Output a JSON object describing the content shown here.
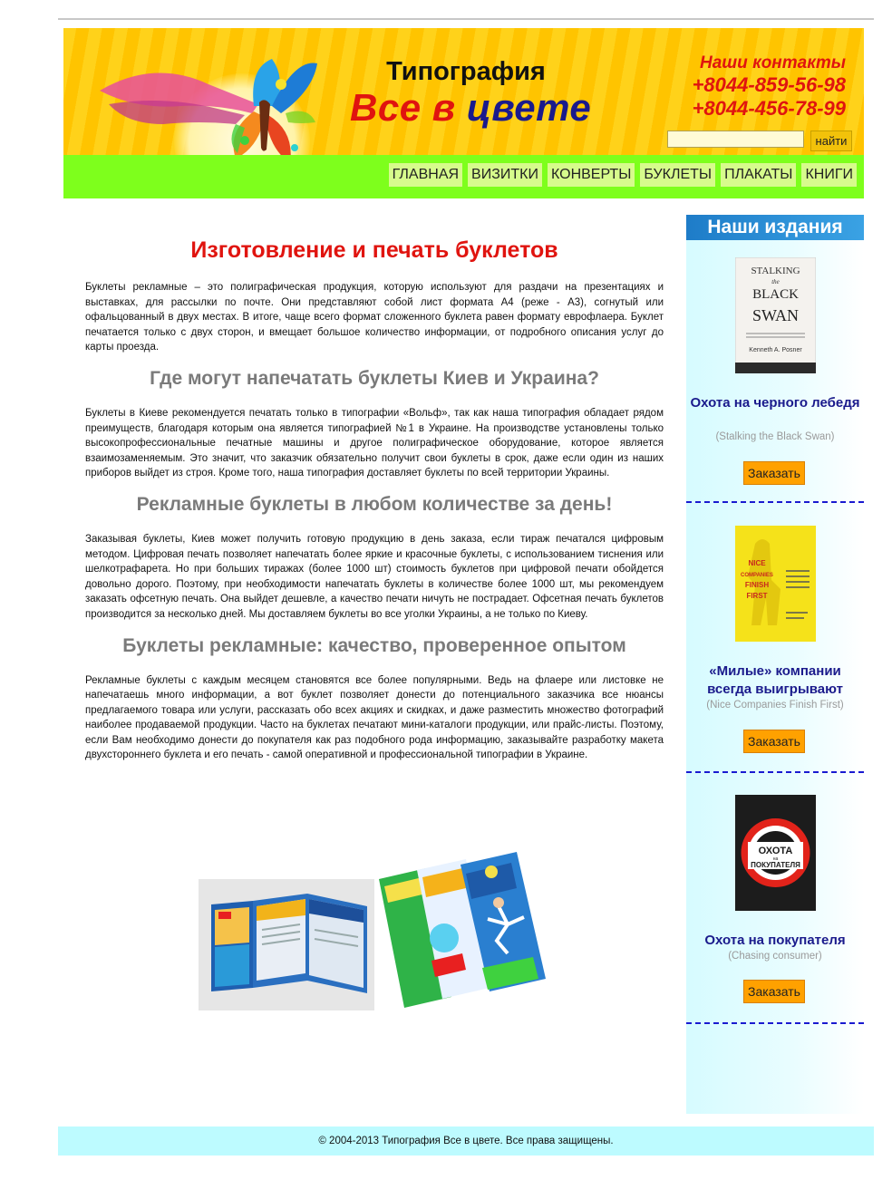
{
  "header": {
    "title_line1": "Типография",
    "title_word1": "Все",
    "title_word2": "в",
    "title_word3": "цвете",
    "contacts_label": "Наши контакты",
    "phone1": "+8044-859-56-98",
    "phone2": "+8044-456-78-99",
    "search_value": "",
    "search_button": "найти"
  },
  "nav": {
    "items": [
      "ГЛАВНАЯ",
      "ВИЗИТКИ",
      "КОНВЕРТЫ",
      "БУКЛЕТЫ",
      "ПЛАКАТЫ",
      "КНИГИ"
    ]
  },
  "main": {
    "h1": "Изготовление и печать буклетов",
    "p1": "Буклеты рекламные – это полиграфическая продукция, которую используют для раздачи на презентациях и выставках, для рассылки по почте. Они представляют собой лист формата А4 (реже - А3), согнутый или офальцованный в двух местах. В итоге, чаще всего формат сложенного буклета равен формату еврофлаера. Буклет печатается только с двух сторон, и вмещает большое количество информации, от подробного описания услуг до карты проезда.",
    "h2a": "Где могут напечатать буклеты Киев и Украина?",
    "p2": "Буклеты в Киеве рекомендуется печатать только в типографии «Вольф», так как наша типография обладает рядом преимуществ, благодаря которым она является типографией №1 в Украине. На производстве установлены только высокопрофессиональные печатные машины и другое полиграфическое оборудование, которое является взаимозаменяемым. Это значит, что заказчик обязательно получит свои буклеты в срок, даже если один из наших приборов выйдет из строя. Кроме того, наша типография доставляет буклеты по всей территории Украины.",
    "h2b": "Рекламные буклеты в любом количестве за день!",
    "p3": "Заказывая буклеты, Киев может получить готовую продукцию в день заказа, если тираж печатался цифровым методом. Цифровая печать позволяет напечатать более яркие и красочные буклеты, с использованием тиснения или шелкотрафарета. Но при больших тиражах (более 1000 шт) стоимость буклетов при цифровой печати обойдется довольно дорого. Поэтому, при необходимости напечатать буклеты в количестве более 1000 шт, мы рекомендуем заказать офсетную печать. Она выйдет дешевле, а качество печати ничуть не пострадает. Офсетная печать буклетов производится за несколько дней. Мы доставляем буклеты во все уголки Украины, а не только по Киеву.",
    "h2c": "Буклеты рекламные: качество, проверенное опытом",
    "p4": "Рекламные буклеты с каждым месяцем становятся все более популярными. Ведь на флаере или листовке не напечатаешь много информации, а вот буклет позволяет донести до потенциального заказчика все нюансы предлагаемого товара или услуги, рассказать обо всех акциях и скидках, и даже разместить множество фотографий наиболее продаваемой продукции. Часто на буклетах печатают мини-каталоги продукции, или прайс-листы. Поэтому, если Вам необходимо донести до покупателя как раз подобного рода информацию, заказывайте разработку макета двухстороннего буклета и его печать - самой оперативной и профессиональной типографии в Украине."
  },
  "sidebar": {
    "title": "Наши издания",
    "books": [
      {
        "title": "Охота на черного лебедя",
        "subtitle": "(Stalking the Black Swan)",
        "order": "Заказать",
        "cover_lines": [
          "STALKING",
          "the",
          "BLACK",
          "SWAN",
          "Kenneth A. Posner"
        ]
      },
      {
        "title": "«Милые» компании всегда выигрывают",
        "subtitle": "(Nice Companies Finish First)",
        "order": "Заказать",
        "cover_lines": [
          "NICE",
          "COMPANIES",
          "FINISH",
          "FIRST"
        ]
      },
      {
        "title": "Охота на покупателя",
        "subtitle": "(Chasing consumer)",
        "order": "Заказать",
        "cover_lines": [
          "ОХОТА",
          "на",
          "ПОКУПАТЕЛЯ"
        ]
      }
    ]
  },
  "footer": {
    "text": "© 2004-2013 Типография Все в цвете. Все права защищены."
  }
}
